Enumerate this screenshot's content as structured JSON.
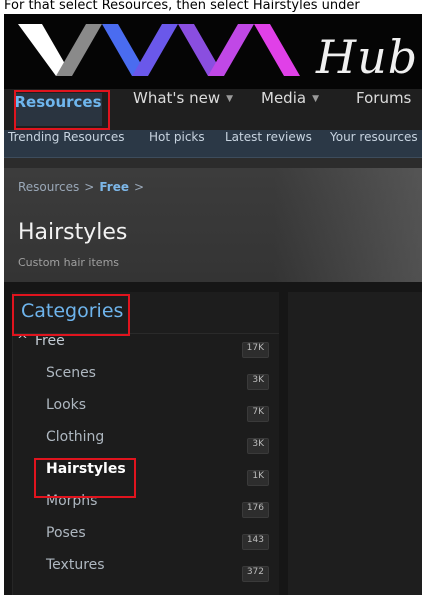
{
  "caption": "For that select Resources, then select Hairstyles under",
  "header": {
    "logo_text": "Hub"
  },
  "nav": {
    "items": [
      {
        "label": "Resources",
        "active": true
      },
      {
        "label": "What's new"
      },
      {
        "label": "Media"
      },
      {
        "label": "Forums"
      }
    ]
  },
  "subnav": {
    "items": [
      "Trending Resources",
      "Hot picks",
      "Latest reviews",
      "Your resources"
    ]
  },
  "breadcrumb": {
    "root": "Resources",
    "current": "Free",
    "separator": ">"
  },
  "page": {
    "title": "Hairstyles",
    "description": "Custom hair items"
  },
  "categories": {
    "heading": "Categories",
    "parent": {
      "label": "Free",
      "count": "17K"
    },
    "items": [
      {
        "label": "Scenes",
        "count": "3K"
      },
      {
        "label": "Looks",
        "count": "7K"
      },
      {
        "label": "Clothing",
        "count": "3K"
      },
      {
        "label": "Hairstyles",
        "count": "1K",
        "active": true
      },
      {
        "label": "Morphs",
        "count": "176"
      },
      {
        "label": "Poses",
        "count": "143"
      },
      {
        "label": "Textures",
        "count": "372"
      }
    ]
  },
  "colors": {
    "accent": "#6fb6ee",
    "highlight": "#e0141e",
    "logo_gray": "#8a8a8a",
    "logo_blue": "#4a6cf0",
    "logo_purple": "#8a4ee0",
    "logo_pink": "#e040e8"
  }
}
